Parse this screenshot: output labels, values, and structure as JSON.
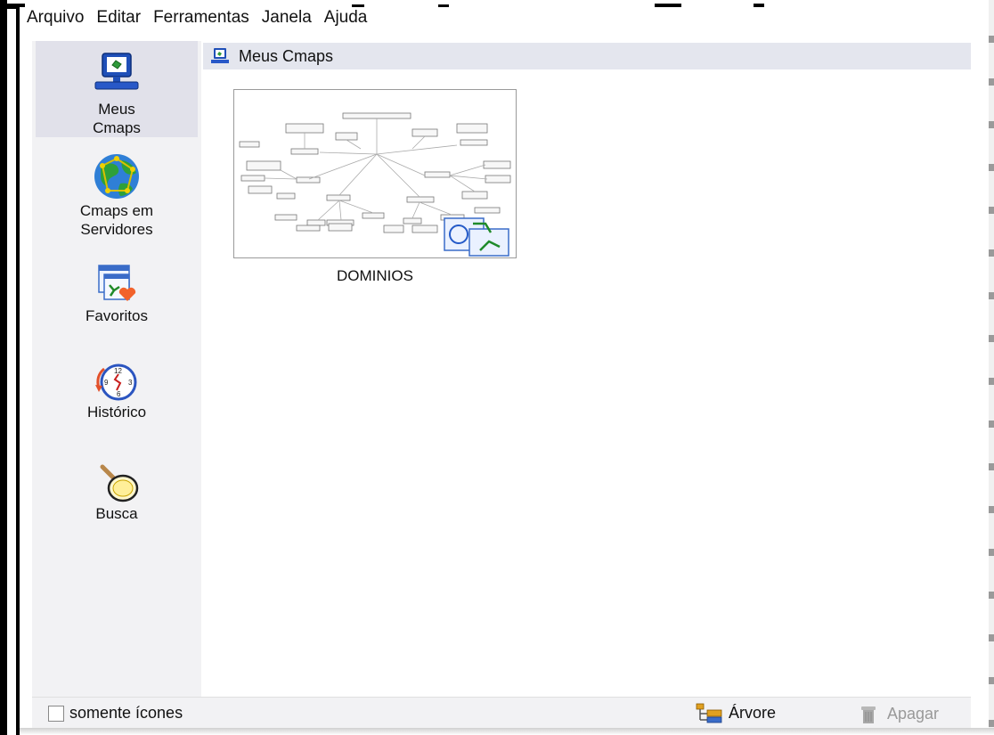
{
  "menu": {
    "items": [
      "Arquivo",
      "Editar",
      "Ferramentas",
      "Janela",
      "Ajuda"
    ]
  },
  "sidebar": {
    "items": [
      {
        "label_line1": "Meus",
        "label_line2": "Cmaps",
        "icon": "computer-icon",
        "selected": true
      },
      {
        "label_line1": "Cmaps em",
        "label_line2": "Servidores",
        "icon": "globe-network-icon",
        "selected": false
      },
      {
        "label_line1": "Favoritos",
        "label_line2": "",
        "icon": "favorites-icon",
        "selected": false
      },
      {
        "label_line1": "Histórico",
        "label_line2": "",
        "icon": "history-clock-icon",
        "selected": false
      },
      {
        "label_line1": "Busca",
        "label_line2": "",
        "icon": "magnifier-icon",
        "selected": false
      }
    ]
  },
  "content": {
    "header_title": "Meus Cmaps",
    "items": [
      {
        "name": "DOMINIOS",
        "icon": "cmap-thumbnail"
      }
    ]
  },
  "statusbar": {
    "checkbox_label": "somente ícones",
    "checkbox_checked": false,
    "tree_button_label": "Árvore",
    "delete_button_label": "Apagar",
    "delete_button_enabled": false
  },
  "colors": {
    "sidebar_bg": "#f2f2f4",
    "selected_bg": "#e1e1ea",
    "header_bg": "#e4e6ee",
    "disabled_text": "#999999"
  }
}
